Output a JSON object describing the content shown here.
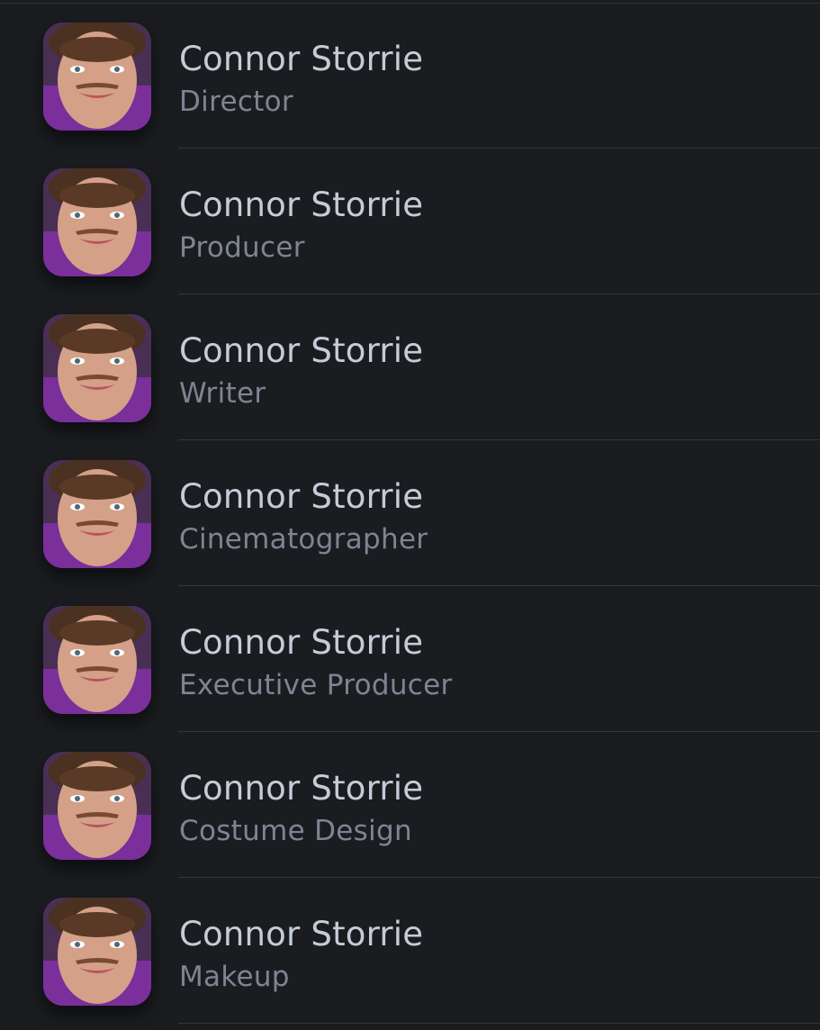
{
  "people": [
    {
      "name": "Connor Storrie",
      "role": "Director"
    },
    {
      "name": "Connor Storrie",
      "role": "Producer"
    },
    {
      "name": "Connor Storrie",
      "role": "Writer"
    },
    {
      "name": "Connor Storrie",
      "role": "Cinematographer"
    },
    {
      "name": "Connor Storrie",
      "role": "Executive Producer"
    },
    {
      "name": "Connor Storrie",
      "role": "Costume Design"
    },
    {
      "name": "Connor Storrie",
      "role": "Makeup"
    }
  ],
  "colors": {
    "background": "#1a1c20",
    "name_text": "#c5ccd6",
    "role_text": "#7d8591",
    "divider": "#33363d"
  }
}
